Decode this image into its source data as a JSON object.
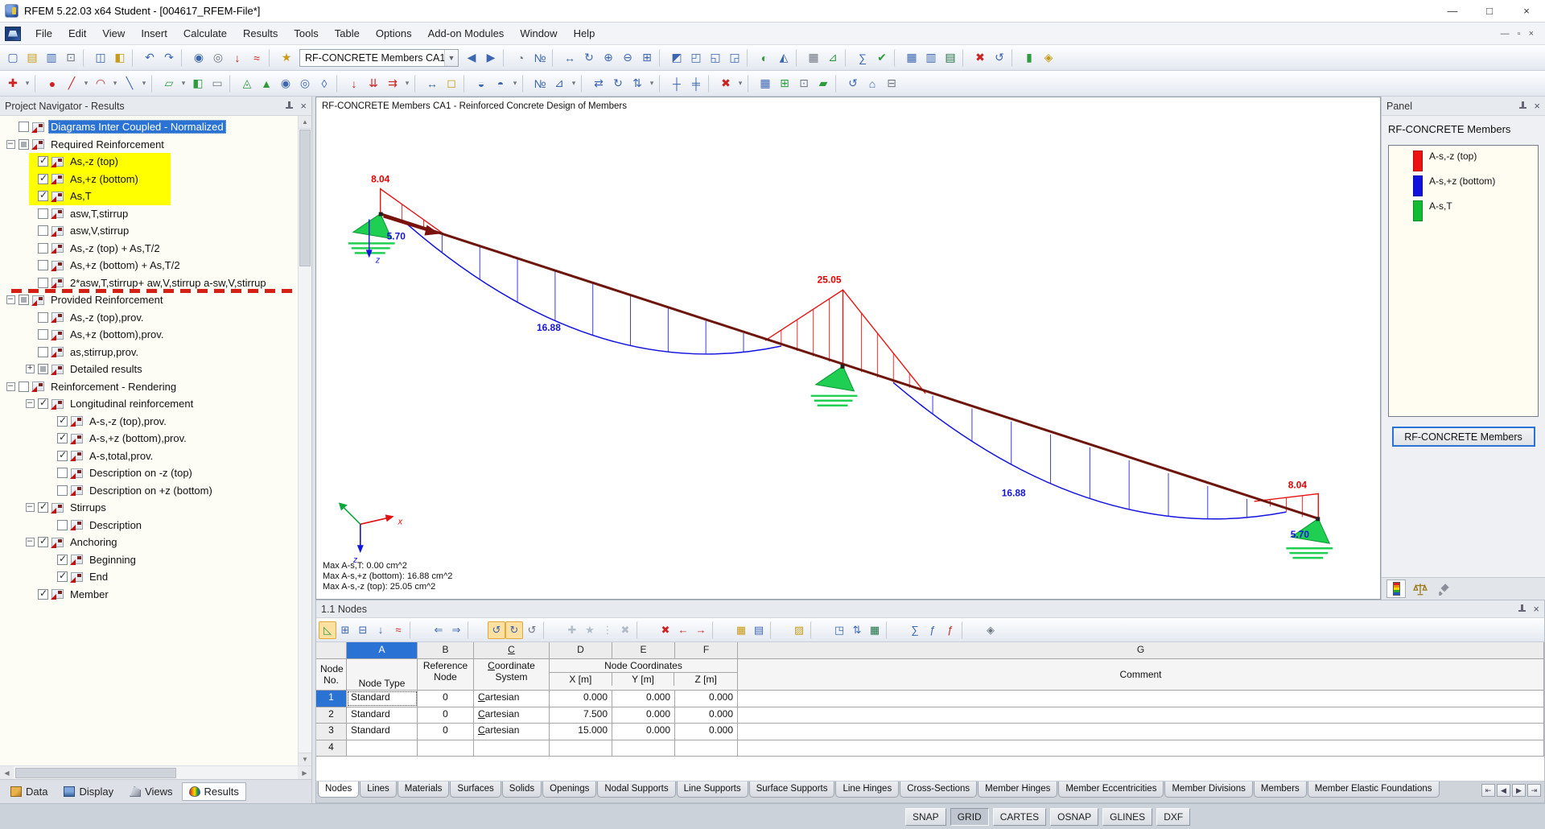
{
  "window": {
    "title": "RFEM 5.22.03 x64 Student - [004617_RFEM-File*]",
    "minimize": "—",
    "maximize": "□",
    "close": "×"
  },
  "menu": {
    "items": [
      "File",
      "Edit",
      "View",
      "Insert",
      "Calculate",
      "Results",
      "Tools",
      "Table",
      "Options",
      "Add-on Modules",
      "Window",
      "Help"
    ],
    "mdi_min": "—",
    "mdi_restore": "▫",
    "mdi_close": "×"
  },
  "toolbar1": {
    "combo_value": "RF-CONCRETE Members CA1 -",
    "left": [
      {
        "n": "new-file-icon",
        "g": "▢",
        "k": "b"
      },
      {
        "n": "open-file-icon",
        "g": "▤",
        "k": "y"
      },
      {
        "n": "save-icon",
        "g": "▥",
        "k": "b"
      },
      {
        "n": "print-icon",
        "g": "⊡",
        "k": "gy"
      },
      {
        "sep": 1
      },
      {
        "n": "copy-icon",
        "g": "◫",
        "k": "b"
      },
      {
        "n": "format-painter-icon",
        "g": "◧",
        "k": "y"
      },
      {
        "sep": 1
      },
      {
        "n": "undo-icon",
        "g": "↶",
        "k": "b"
      },
      {
        "n": "redo-icon",
        "g": "↷",
        "k": "b"
      },
      {
        "sep": 1
      },
      {
        "n": "render-mode-icon",
        "g": "◉",
        "k": "b"
      },
      {
        "n": "wireframe-mode-icon",
        "g": "◎",
        "k": "gy"
      },
      {
        "n": "show-loads-icon",
        "g": "↓",
        "k": "r"
      },
      {
        "n": "show-results-icon",
        "g": "≈",
        "k": "r"
      },
      {
        "sep": 1
      },
      {
        "n": "new-case-icon",
        "g": "★",
        "k": "y"
      }
    ],
    "right": [
      {
        "n": "back-icon",
        "g": "◀",
        "k": "b"
      },
      {
        "n": "forward-icon",
        "g": "▶",
        "k": "b"
      },
      {
        "sep": 1
      },
      {
        "n": "search-loupe-icon",
        "g": "◔",
        "k": "gy"
      },
      {
        "n": "numbering-icon",
        "g": "№",
        "k": "b"
      },
      {
        "sep": 1
      },
      {
        "n": "move-view-icon",
        "g": "↔",
        "k": "b"
      },
      {
        "n": "rotate-view-icon",
        "g": "↻",
        "k": "b"
      },
      {
        "n": "zoom-in-icon",
        "g": "⊕",
        "k": "b"
      },
      {
        "n": "zoom-out-icon",
        "g": "⊖",
        "k": "b"
      },
      {
        "n": "zoom-window-icon",
        "g": "⊞",
        "k": "b"
      },
      {
        "sep": 1
      },
      {
        "n": "view-iso-icon",
        "g": "◩",
        "k": "b"
      },
      {
        "n": "view-xy-icon",
        "g": "◰",
        "k": "b"
      },
      {
        "n": "view-xz-icon",
        "g": "◱",
        "k": "b"
      },
      {
        "n": "view-yz-icon",
        "g": "◲",
        "k": "b"
      },
      {
        "sep": 1
      },
      {
        "n": "visibility-icon",
        "g": "◐",
        "k": "g"
      },
      {
        "n": "section-icon",
        "g": "◭",
        "k": "b"
      },
      {
        "sep": 1
      },
      {
        "n": "grid-snap-icon",
        "g": "▦",
        "k": "gy"
      },
      {
        "n": "work-plane-icon",
        "g": "⊿",
        "k": "g"
      },
      {
        "sep": 1
      },
      {
        "n": "calculate-all-icon",
        "g": "∑",
        "k": "b"
      },
      {
        "n": "check-model-icon",
        "g": "✔",
        "k": "g"
      },
      {
        "sep": 1
      },
      {
        "n": "tables-toggle-icon",
        "g": "▦",
        "k": "b"
      },
      {
        "n": "panel-toggle-icon",
        "g": "▥",
        "k": "b"
      },
      {
        "n": "excel-export-icon",
        "g": "▤",
        "k": "xl"
      },
      {
        "sep": 1
      },
      {
        "n": "delete-results-icon",
        "g": "✖",
        "k": "r"
      },
      {
        "n": "regenerate-icon",
        "g": "↺",
        "k": "b"
      },
      {
        "sep": 1
      },
      {
        "n": "color-scale-icon",
        "g": "▮",
        "k": "g"
      },
      {
        "n": "display-properties-icon",
        "g": "◈",
        "k": "y"
      }
    ]
  },
  "toolbar2": {
    "icons": [
      {
        "n": "select-objects-icon",
        "g": "✚",
        "k": "r"
      },
      {
        "n": "dropdown-caret-icon",
        "g": "▾",
        "k": "gy",
        "caret": 1
      },
      {
        "sep": 1
      },
      {
        "n": "new-node-icon",
        "g": "●",
        "k": "r"
      },
      {
        "n": "new-line-icon",
        "g": "╱",
        "k": "r"
      },
      {
        "n": "dropdown-caret-icon",
        "g": "▾",
        "k": "gy",
        "caret": 1
      },
      {
        "n": "new-arc-icon",
        "g": "◠",
        "k": "r"
      },
      {
        "n": "dropdown-caret-icon",
        "g": "▾",
        "k": "gy",
        "caret": 1
      },
      {
        "n": "new-member-icon",
        "g": "╲",
        "k": "b"
      },
      {
        "n": "dropdown-caret-icon",
        "g": "▾",
        "k": "gy",
        "caret": 1
      },
      {
        "sep": 1
      },
      {
        "n": "new-surface-icon",
        "g": "▱",
        "k": "g"
      },
      {
        "n": "dropdown-caret-icon",
        "g": "▾",
        "k": "gy",
        "caret": 1
      },
      {
        "n": "new-solid-icon",
        "g": "◧",
        "k": "g"
      },
      {
        "n": "new-opening-icon",
        "g": "▭",
        "k": "gy"
      },
      {
        "sep": 1
      },
      {
        "n": "nodal-support-icon",
        "g": "◬",
        "k": "g"
      },
      {
        "n": "line-support-icon",
        "g": "▲",
        "k": "g"
      },
      {
        "n": "member-hinge-icon",
        "g": "◉",
        "k": "b"
      },
      {
        "n": "line-hinge-icon",
        "g": "◎",
        "k": "b"
      },
      {
        "n": "eccentricity-icon",
        "g": "◊",
        "k": "b"
      },
      {
        "sep": 1
      },
      {
        "n": "nodal-load-icon",
        "g": "↓",
        "k": "r"
      },
      {
        "n": "member-load-icon",
        "g": "⇊",
        "k": "r"
      },
      {
        "n": "surface-load-icon",
        "g": "⇉",
        "k": "r"
      },
      {
        "n": "dropdown-caret-icon",
        "g": "▾",
        "k": "gy",
        "caret": 1
      },
      {
        "sep": 1
      },
      {
        "n": "dimension-icon",
        "g": "↔",
        "k": "b"
      },
      {
        "n": "comment-icon",
        "g": "◻",
        "k": "y"
      },
      {
        "sep": 1
      },
      {
        "n": "visibility-modes-icon",
        "g": "◒",
        "k": "b"
      },
      {
        "n": "user-views-icon",
        "g": "◓",
        "k": "b"
      },
      {
        "n": "dropdown-caret-icon",
        "g": "▾",
        "k": "gy",
        "caret": 1
      },
      {
        "sep": 1
      },
      {
        "n": "renumber-icon",
        "g": "№",
        "k": "b"
      },
      {
        "n": "measure-icon",
        "g": "⊿",
        "k": "b"
      },
      {
        "n": "dropdown-caret-icon",
        "g": "▾",
        "k": "gy",
        "caret": 1
      },
      {
        "sep": 1
      },
      {
        "n": "move-copy-icon",
        "g": "⇄",
        "k": "b"
      },
      {
        "n": "rotate-copy-icon",
        "g": "↻",
        "k": "b"
      },
      {
        "n": "mirror-icon",
        "g": "⇅",
        "k": "b"
      },
      {
        "n": "dropdown-caret-icon",
        "g": "▾",
        "k": "gy",
        "caret": 1
      },
      {
        "sep": 1
      },
      {
        "n": "connect-lines-icon",
        "g": "┼",
        "k": "b"
      },
      {
        "n": "divide-line-icon",
        "g": "╪",
        "k": "b"
      },
      {
        "sep": 1
      },
      {
        "n": "delete-icon",
        "g": "✖",
        "k": "r"
      },
      {
        "n": "dropdown-caret-icon",
        "g": "▾",
        "k": "gy",
        "caret": 1
      },
      {
        "sep": 1
      },
      {
        "n": "table-layout-icon",
        "g": "▦",
        "k": "b"
      },
      {
        "n": "quick-input-icon",
        "g": "⊞",
        "k": "g"
      },
      {
        "n": "snap-settings-icon",
        "g": "⊡",
        "k": "gy"
      },
      {
        "n": "work-plane2-icon",
        "g": "▰",
        "k": "g"
      },
      {
        "sep": 1
      },
      {
        "n": "last-view-icon",
        "g": "↺",
        "k": "b"
      },
      {
        "n": "full-view-icon",
        "g": "⌂",
        "k": "b"
      },
      {
        "n": "print-graphic-icon",
        "g": "⊟",
        "k": "gy"
      }
    ]
  },
  "navigator": {
    "title": "Project Navigator - Results",
    "tree": [
      {
        "t": "Diagrams Inter Coupled - Normalized",
        "lv": 1,
        "c": "off",
        "e": "n",
        "sel": 1
      },
      {
        "t": "Required Reinforcement",
        "lv": 1,
        "c": "mix",
        "e": "m"
      },
      {
        "t": "As,-z (top)",
        "lv": 2,
        "c": "on",
        "e": "n",
        "hl": 1
      },
      {
        "t": "As,+z (bottom)",
        "lv": 2,
        "c": "on",
        "e": "n",
        "hl": 1
      },
      {
        "t": "As,T",
        "lv": 2,
        "c": "on",
        "e": "n",
        "hl": 1
      },
      {
        "t": "asw,T,stirrup",
        "lv": 2,
        "c": "off",
        "e": "n"
      },
      {
        "t": "asw,V,stirrup",
        "lv": 2,
        "c": "off",
        "e": "n"
      },
      {
        "t": "As,-z (top) + As,T/2",
        "lv": 2,
        "c": "off",
        "e": "n"
      },
      {
        "t": "As,+z (bottom) + As,T/2",
        "lv": 2,
        "c": "off",
        "e": "n"
      },
      {
        "t": "2*asw,T,stirrup+ aw,V,stirrup a-sw,V,stirrup",
        "lv": 2,
        "c": "off",
        "e": "n",
        "dash": 1
      },
      {
        "t": "Provided Reinforcement",
        "lv": 1,
        "c": "mix",
        "e": "m"
      },
      {
        "t": "As,-z (top),prov.",
        "lv": 2,
        "c": "off",
        "e": "n"
      },
      {
        "t": "As,+z (bottom),prov.",
        "lv": 2,
        "c": "off",
        "e": "n"
      },
      {
        "t": "as,stirrup,prov.",
        "lv": 2,
        "c": "off",
        "e": "n"
      },
      {
        "t": "Detailed results",
        "lv": 2,
        "c": "mix",
        "e": "p"
      },
      {
        "t": "Reinforcement - Rendering",
        "lv": 1,
        "c": "off",
        "e": "m"
      },
      {
        "t": "Longitudinal reinforcement",
        "lv": 2,
        "c": "on",
        "e": "m"
      },
      {
        "t": "A-s,-z (top),prov.",
        "lv": 3,
        "c": "on",
        "e": "n"
      },
      {
        "t": "A-s,+z (bottom),prov.",
        "lv": 3,
        "c": "on",
        "e": "n"
      },
      {
        "t": "A-s,total,prov.",
        "lv": 3,
        "c": "on",
        "e": "n"
      },
      {
        "t": "Description on -z (top)",
        "lv": 3,
        "c": "off",
        "e": "n"
      },
      {
        "t": "Description on +z (bottom)",
        "lv": 3,
        "c": "off",
        "e": "n"
      },
      {
        "t": "Stirrups",
        "lv": 2,
        "c": "on",
        "e": "m"
      },
      {
        "t": "Description",
        "lv": 3,
        "c": "off",
        "e": "n"
      },
      {
        "t": "Anchoring",
        "lv": 2,
        "c": "on",
        "e": "m"
      },
      {
        "t": "Beginning",
        "lv": 3,
        "c": "on",
        "e": "n"
      },
      {
        "t": "End",
        "lv": 3,
        "c": "on",
        "e": "n"
      },
      {
        "t": "Member",
        "lv": 2,
        "c": "on",
        "e": "n"
      }
    ],
    "tabs": [
      {
        "label": "Data",
        "ic": "data"
      },
      {
        "label": "Display",
        "ic": "display"
      },
      {
        "label": "Views",
        "ic": "views"
      },
      {
        "label": "Results",
        "ic": "results",
        "active": 1
      }
    ]
  },
  "graphics": {
    "title": "RF-CONCRETE Members CA1 - Reinforced Concrete Design of Members",
    "labels": {
      "left_top": "8.04",
      "left_bottom": "5.70",
      "span1": "16.88",
      "mid": "25.05",
      "span2": "16.88",
      "right_top": "8.04",
      "right_bottom": "5.70"
    },
    "axes": {
      "x": "x",
      "z": "z",
      "node_z": "z"
    },
    "max_lines": [
      "Max A-s,T: 0.00 cm^2",
      "Max A-s,+z (bottom): 16.88 cm^2",
      "Max A-s,-z (top): 25.05 cm^2"
    ]
  },
  "panel": {
    "title": "Panel",
    "heading": "RF-CONCRETE Members",
    "legend": [
      {
        "label": "A-s,-z (top)",
        "css": "background:#ee1111"
      },
      {
        "label": "A-s,+z (bottom)",
        "css": "background:#1111dd"
      },
      {
        "label": "A-s,T",
        "css": "background:#11bb33"
      }
    ],
    "button": "RF-CONCRETE Members"
  },
  "table": {
    "title": "1.1 Nodes",
    "toolbar": [
      {
        "n": "table-edit-mode-icon",
        "g": "◺",
        "k": "g",
        "sel": 1
      },
      {
        "n": "insert-row-icon",
        "g": "⊞",
        "k": "b"
      },
      {
        "n": "delete-row-icon",
        "g": "⊟",
        "k": "b"
      },
      {
        "n": "fill-down-icon",
        "g": "↓",
        "k": "b"
      },
      {
        "n": "result-diagram-icon",
        "g": "≈",
        "k": "r"
      },
      {
        "sep": 1
      },
      {
        "n": "prev-table-icon",
        "g": "⇐",
        "k": "b"
      },
      {
        "n": "next-table-icon",
        "g": "⇒",
        "k": "b"
      },
      {
        "sep": 1
      },
      {
        "n": "jump-back-icon",
        "g": "↺",
        "k": "b",
        "sel": 1
      },
      {
        "n": "jump-forward-icon",
        "g": "↻",
        "k": "b",
        "sel": 1
      },
      {
        "n": "sync-table-icon",
        "g": "↺",
        "k": "gy"
      },
      {
        "sep": 1
      },
      {
        "n": "add-filter-icon",
        "g": "✚",
        "k": "dim"
      },
      {
        "n": "star-filter-icon",
        "g": "★",
        "k": "dim"
      },
      {
        "n": "options-icon",
        "g": "⋮",
        "k": "dim"
      },
      {
        "n": "clear-filter-icon",
        "g": "✖",
        "k": "dim"
      },
      {
        "sep": 1
      },
      {
        "n": "delete-all-rows-icon",
        "g": "✖",
        "k": "r"
      },
      {
        "n": "remove-left-icon",
        "g": "←",
        "k": "r"
      },
      {
        "n": "remove-right-icon",
        "g": "→",
        "k": "r"
      },
      {
        "sep": 1
      },
      {
        "n": "select-table-icon",
        "g": "▦",
        "k": "y"
      },
      {
        "n": "format-table-icon",
        "g": "▤",
        "k": "b"
      },
      {
        "sep": 1
      },
      {
        "n": "notes-icon",
        "g": "▨",
        "k": "y"
      },
      {
        "sep": 1
      },
      {
        "n": "export-report-icon",
        "g": "◳",
        "k": "b"
      },
      {
        "n": "import-export-icon",
        "g": "⇅",
        "k": "b"
      },
      {
        "n": "export-excel-icon",
        "g": "▦",
        "k": "xl"
      },
      {
        "sep": 1
      },
      {
        "n": "sum-icon",
        "g": "∑",
        "k": "b"
      },
      {
        "n": "fx-icon",
        "g": "ƒ",
        "k": "b"
      },
      {
        "n": "fx-delete-icon",
        "g": "ƒ",
        "k": "r"
      },
      {
        "sep": 1
      },
      {
        "n": "lock-table-icon",
        "g": "◈",
        "k": "gy"
      }
    ],
    "letters": [
      "A",
      "B",
      "C",
      "D",
      "E",
      "F",
      "G"
    ],
    "headers": {
      "no1": "Node",
      "no2": "No.",
      "type": "Node Type",
      "ref1": "Reference",
      "ref2": "Node",
      "cs1": "Coordinate",
      "cs2": "System",
      "group": "Node Coordinates",
      "x": "X [m]",
      "y": "Y [m]",
      "z": "Z [m]",
      "comment": "Comment"
    },
    "rows": [
      {
        "no": "1",
        "type": "Standard",
        "ref": "0",
        "cs": "Cartesian",
        "x": "0.000",
        "y": "0.000",
        "z": "0.000",
        "comment": "",
        "cur": 1
      },
      {
        "no": "2",
        "type": "Standard",
        "ref": "0",
        "cs": "Cartesian",
        "x": "7.500",
        "y": "0.000",
        "z": "0.000",
        "comment": ""
      },
      {
        "no": "3",
        "type": "Standard",
        "ref": "0",
        "cs": "Cartesian",
        "x": "15.000",
        "y": "0.000",
        "z": "0.000",
        "comment": ""
      },
      {
        "no": "4",
        "type": "",
        "ref": "",
        "cs": "",
        "x": "",
        "y": "",
        "z": "",
        "comment": ""
      }
    ],
    "tabs": [
      {
        "label": "Nodes",
        "active": 1
      },
      {
        "label": "Lines"
      },
      {
        "label": "Materials"
      },
      {
        "label": "Surfaces"
      },
      {
        "label": "Solids"
      },
      {
        "label": "Openings"
      },
      {
        "label": "Nodal Supports"
      },
      {
        "label": "Line Supports"
      },
      {
        "label": "Surface Supports"
      },
      {
        "label": "Line Hinges"
      },
      {
        "label": "Cross-Sections"
      },
      {
        "label": "Member Hinges"
      },
      {
        "label": "Member Eccentricities"
      },
      {
        "label": "Member Divisions"
      },
      {
        "label": "Members"
      },
      {
        "label": "Member Elastic Foundations"
      }
    ],
    "nav": [
      {
        "n": "first-table-tab-button",
        "g": "⇤"
      },
      {
        "n": "prev-table-tab-button",
        "g": "◀"
      },
      {
        "n": "next-table-tab-button",
        "g": "▶"
      },
      {
        "n": "last-table-tab-button",
        "g": "⇥"
      }
    ]
  },
  "status": {
    "buttons": [
      {
        "label": "SNAP"
      },
      {
        "label": "GRID",
        "pressed": 1
      },
      {
        "label": "CARTES"
      },
      {
        "label": "OSNAP"
      },
      {
        "label": "GLINES"
      },
      {
        "label": "DXF"
      }
    ]
  }
}
